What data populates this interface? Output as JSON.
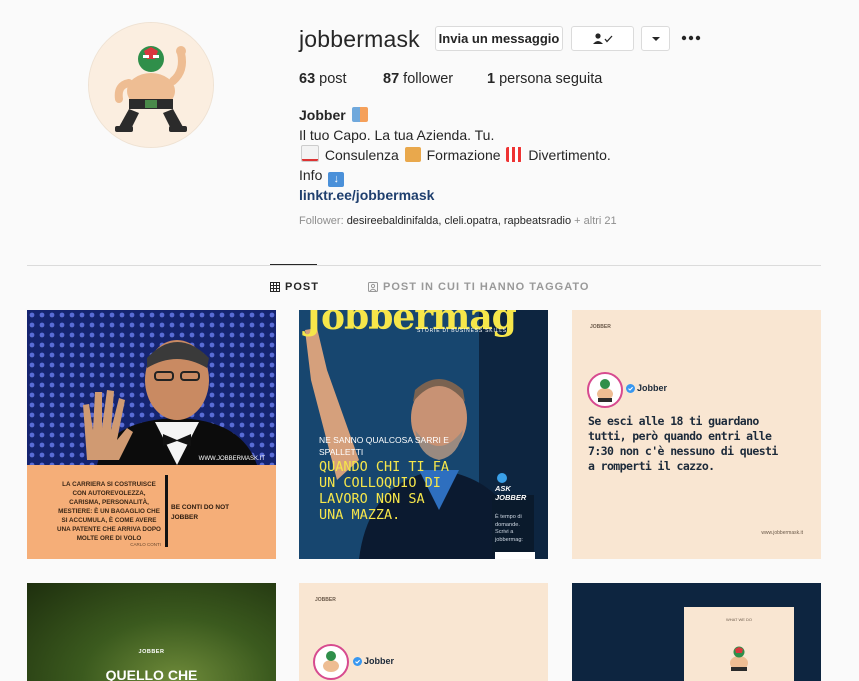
{
  "profile": {
    "username": "jobbermask",
    "message_button": "Invia un messaggio",
    "stats": {
      "posts_count": "63",
      "posts_label": "post",
      "followers_count": "87",
      "followers_label": "follower",
      "following_count": "1",
      "following_label": "persona seguita"
    },
    "bio": {
      "name": "Jobber",
      "line1": "Il tuo Capo. La tua Azienda. Tu.",
      "line2_a": "Consulenza",
      "line2_b": "Formazione",
      "line2_c": "Divertimento.",
      "line3": "Info",
      "link": "linktr.ee/jobbermask"
    },
    "followed_by": {
      "prefix": "Follower:",
      "names": "desireebaldinifalda, cleli.opatra, rapbeatsradio",
      "more": "+ altri 21"
    }
  },
  "tabs": {
    "posts": "POST",
    "tagged": "POST IN CUI TI HANNO TAGGATO"
  },
  "posts": {
    "p1": {
      "watermark": "WWW.JOBBERMASK.IT",
      "quote": "LA CARRIERA SI COSTRUISCE CON AUTOREVOLEZZA, CARISMA, PERSONALITÀ, MESTIERE: È UN BAGAGLIO CHE SI ACCUMULA, È COME AVERE UNA PATENTE CHE ARRIVA DOPO MOLTE ORE DI VOLO",
      "author": "CARLO CONTI",
      "side": "BE CONTI DO NOT JOBBER"
    },
    "p2": {
      "masthead": "Jobbermag",
      "subtitle": "STORIE DI BUSINESS SKILLS",
      "kicker": "NE SANNO QUALCOSA SARRI E SPALLETTI",
      "headline": "QUANDO CHI TI FA UN COLLOQUIO DI LAVORO NON SA UNA MAZZA.",
      "ask_title": "ASK JOBBER",
      "ask_text": "È tempo di domande. Scrivi a jobbermag:"
    },
    "p3": {
      "brand": "JOBBER",
      "account": "Jobber",
      "text": "Se esci alle 18 ti guardano tutti, però quando entri alle 7:30 non c'è nessuno di questi a romperti il cazzo.",
      "url": "www.jobbermask.it"
    },
    "p4": {
      "brand": "JOBBER",
      "headline": "QUELLO CHE"
    },
    "p5": {
      "brand": "JOBBER",
      "account": "Jobber"
    },
    "p6": {
      "caption": "WHAT WE DO"
    }
  },
  "colors": {
    "peach": "#f9e6d2",
    "orange_panel": "#f5ae78",
    "navy": "#0d2540",
    "link": "#1f3f6e",
    "yellow": "#f6e64a"
  }
}
